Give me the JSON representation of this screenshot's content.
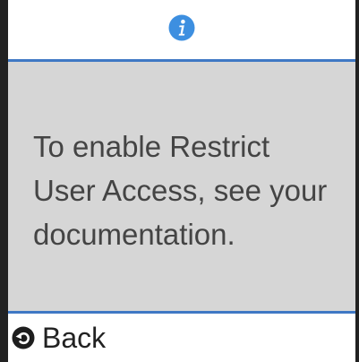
{
  "header": {
    "icon": "info-icon",
    "icon_color": "#3d8fe0"
  },
  "message": {
    "text": "To enable Restrict User Access, see your documentation."
  },
  "footer": {
    "back_icon": "back-arrow-icon",
    "back_label": "Back"
  },
  "colors": {
    "panel_background": "#d6d6d6",
    "divider": "#3f78c4",
    "text": "#444444"
  }
}
